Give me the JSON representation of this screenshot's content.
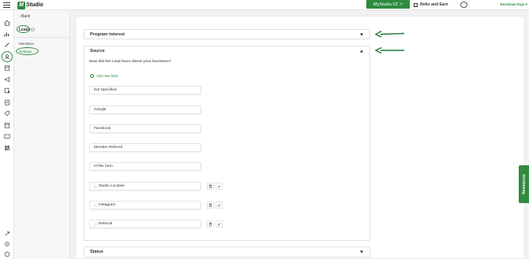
{
  "header": {
    "logo_mark": "M",
    "logo_text": "Studio",
    "studio_v2_label": "MyStudio V2 ↗",
    "refer_label": "Refer and Earn",
    "chat_icon": "chat-bubble-icon",
    "user_name": "Renshaw Dojo ▾"
  },
  "subnav": {
    "back_label": "Back",
    "section_label": "Leads",
    "items": [
      {
        "label": "Members"
      },
      {
        "label": "Settings"
      }
    ]
  },
  "accordions": {
    "program_interest": "Program Interest",
    "source": "Source",
    "status": "Status"
  },
  "source": {
    "question": "How did the Lead learn about your business?",
    "add_field_label": "Add new field",
    "fixed_fields": [
      "Not Specified",
      "Google",
      "Facebook",
      "Member Referral",
      "HTML form"
    ],
    "custom_fields": [
      "Studio Location",
      "Instagram",
      "Referral"
    ]
  },
  "resources_label": "Resources",
  "colors": {
    "brand_green": "#2e8b3e",
    "annotation_green": "#1e7a33"
  }
}
